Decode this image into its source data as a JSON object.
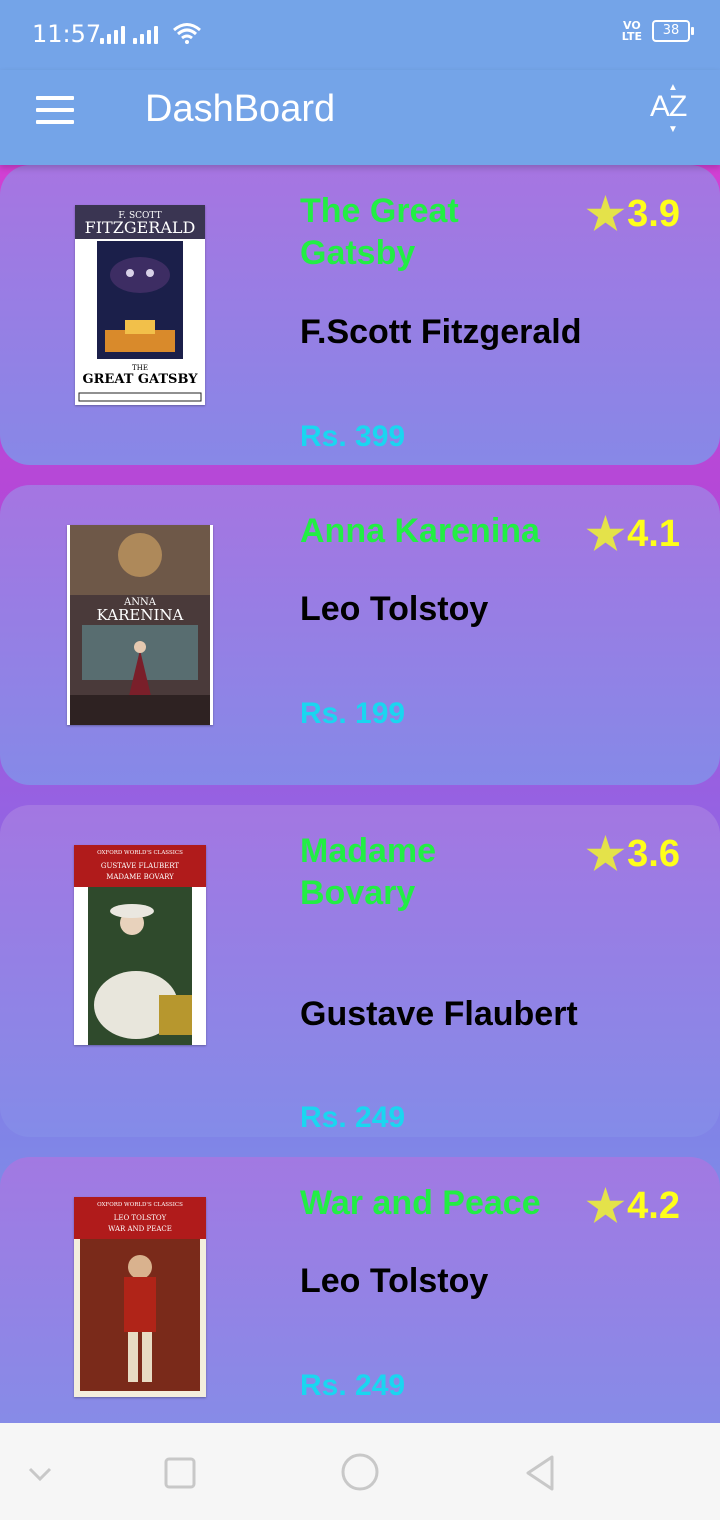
{
  "status_bar": {
    "time": "11:57",
    "volte_line1": "VO",
    "volte_line2": "LTE",
    "battery": "38"
  },
  "app_bar": {
    "title": "DashBoard",
    "menu_icon": "hamburger-menu-icon",
    "sort_icon": "sort-az-icon",
    "sort_label": "AZ"
  },
  "colors": {
    "title_green": "#22ee44",
    "rating_yellow": "#ffff1a",
    "price_cyan": "#1ad6f0",
    "app_bar_blue": "#74a4e8"
  },
  "books": [
    {
      "title": "The Great Gatsby",
      "author": "F.Scott Fitzgerald",
      "price": "Rs. 399",
      "rating": "3.9",
      "cover_top_text": "F. SCOTT",
      "cover_top_text2": "FITZGERALD",
      "cover_bottom_text": "THE",
      "cover_bottom_text2": "GREAT GATSBY"
    },
    {
      "title": "Anna Karenina",
      "author": "Leo Tolstoy",
      "price": "Rs. 199",
      "rating": "4.1",
      "cover_top_text": "ANNA",
      "cover_top_text2": "KARENINA"
    },
    {
      "title": "Madame Bovary",
      "author": "Gustave Flaubert",
      "price": "Rs. 249",
      "rating": "3.6",
      "cover_top_text": "OXFORD WORLD'S CLASSICS",
      "cover_top_text2": "GUSTAVE FLAUBERT",
      "cover_top_text3": "MADAME BOVARY"
    },
    {
      "title": "War and Peace",
      "author": "Leo Tolstoy",
      "price": "Rs. 249",
      "rating": "4.2",
      "cover_top_text": "OXFORD WORLD'S CLASSICS",
      "cover_top_text2": "LEO TOLSTOY",
      "cover_top_text3": "WAR AND PEACE"
    }
  ],
  "nav_bar": {
    "items": [
      "nav-down-icon",
      "recents-square-icon",
      "home-circle-icon",
      "back-triangle-icon"
    ]
  }
}
